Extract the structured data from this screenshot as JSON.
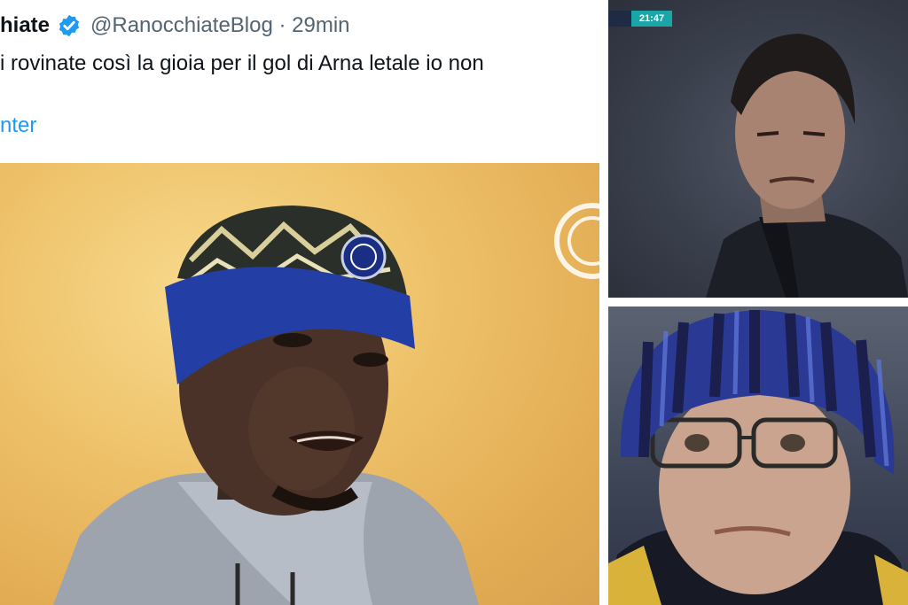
{
  "tweet": {
    "display_name": "hiate",
    "handle_time": "@RanocchiateBlog · 29min",
    "text": "i rovinate così la gioia per il gol di Arna letale io non",
    "link": "nter"
  },
  "scoreboard": {
    "clock": "21:47"
  },
  "colors": {
    "link": "#1d9bf0",
    "verified": "#1d9bf0",
    "scoreboard_accent": "#1aa6a6"
  }
}
